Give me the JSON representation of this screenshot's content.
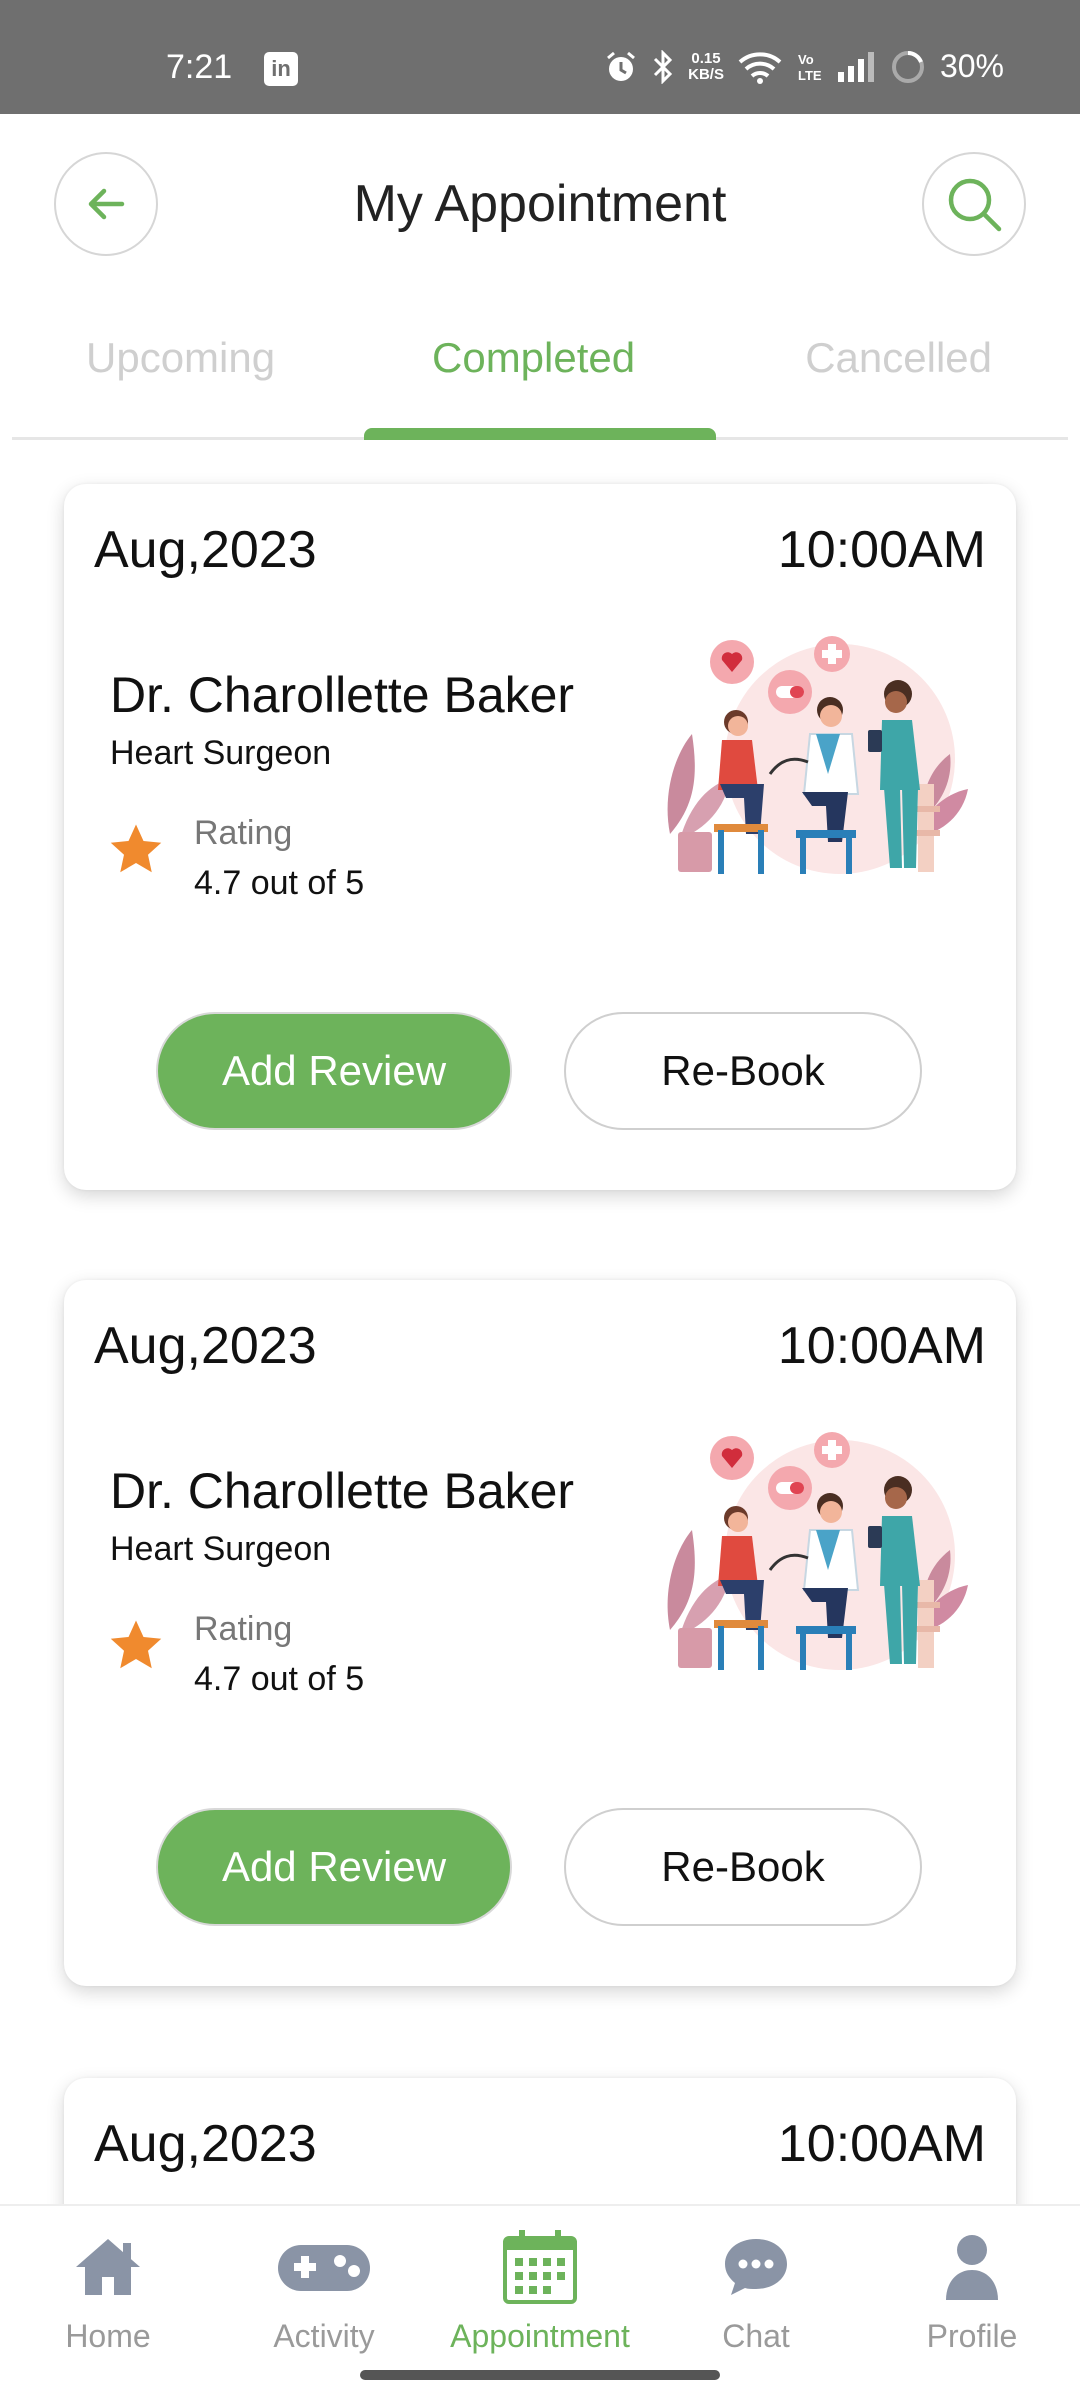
{
  "status_bar": {
    "time": "7:21",
    "linkedin": "in",
    "speed_top": "0.15",
    "speed_bottom": "KB/S",
    "battery": "30%"
  },
  "header": {
    "title": "My Appointment",
    "back_icon": "back-arrow-icon",
    "search_icon": "search-icon"
  },
  "tabs": [
    {
      "label": "Upcoming",
      "active": false
    },
    {
      "label": "Completed",
      "active": true
    },
    {
      "label": "Cancelled",
      "active": false
    }
  ],
  "appointments": [
    {
      "date": "Aug,2023",
      "time": "10:00AM",
      "doctor": "Dr. Charollette Baker",
      "specialty": "Heart Surgeon",
      "rating_label": "Rating",
      "rating_value": "4.7 out of 5",
      "review_button": "Add Review",
      "rebook_button": "Re-Book"
    },
    {
      "date": "Aug,2023",
      "time": "10:00AM",
      "doctor": "Dr. Charollette Baker",
      "specialty": "Heart Surgeon",
      "rating_label": "Rating",
      "rating_value": "4.7 out of 5",
      "review_button": "Add Review",
      "rebook_button": "Re-Book"
    },
    {
      "date": "Aug,2023",
      "time": "10:00AM"
    }
  ],
  "bottom_nav": [
    {
      "label": "Home",
      "icon": "home-icon",
      "active": false
    },
    {
      "label": "Activity",
      "icon": "gamepad-icon",
      "active": false
    },
    {
      "label": "Appointment",
      "icon": "calendar-icon",
      "active": true
    },
    {
      "label": "Chat",
      "icon": "chat-icon",
      "active": false
    },
    {
      "label": "Profile",
      "icon": "profile-icon",
      "active": false
    }
  ],
  "colors": {
    "accent": "#6db35b",
    "star": "#f08a2e",
    "status_bar": "#6f6f6f",
    "inactive": "#9a9a9a"
  }
}
